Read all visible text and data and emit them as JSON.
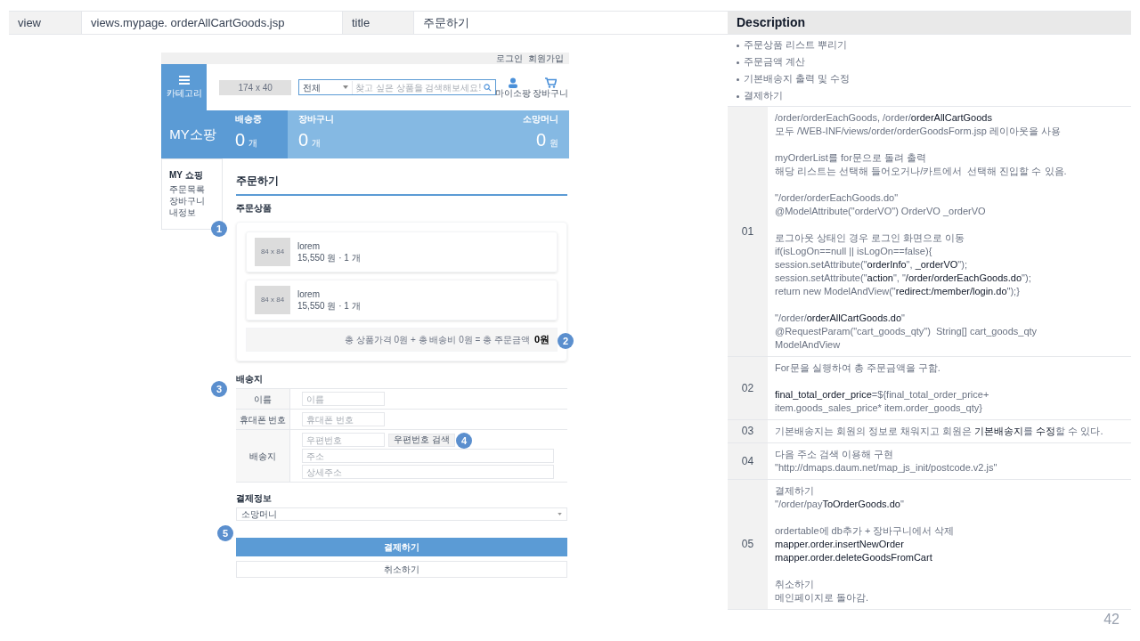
{
  "header": {
    "view_label": "view",
    "view_value": "views.mypage. orderAllCartGoods.jsp",
    "title_label": "title",
    "title_value": "주문하기",
    "description_label": "Description"
  },
  "mockup": {
    "top_links": [
      "로그인",
      "회원가입"
    ],
    "category_button": "카테고리",
    "logo_placeholder": "174 x 40",
    "search": {
      "category": "전체",
      "placeholder": "찾고 싶은 상품을 검색해보세요!"
    },
    "header_icons": [
      {
        "kind": "user",
        "label": "마이소팡"
      },
      {
        "kind": "cart",
        "label": "장바구니"
      }
    ],
    "banner": {
      "title": "MY소팡",
      "stats": [
        {
          "label": "배송중",
          "value": "0",
          "unit": "개"
        },
        {
          "label": "장바구니",
          "value": "0",
          "unit": "개"
        },
        {
          "label": "소망머니",
          "value": "0",
          "unit": "원"
        }
      ]
    },
    "sidebar": {
      "title": "MY 쇼핑",
      "items": [
        "주문목록",
        "장바구니",
        "내정보"
      ]
    },
    "page_title": "주문하기",
    "goods_section": "주문상품",
    "goods": [
      {
        "thumb": "84 x 84",
        "name": "lorem",
        "price": "15,550 원 · 1 개"
      },
      {
        "thumb": "84 x 84",
        "name": "lorem",
        "price": "15,550 원 · 1 개"
      }
    ],
    "summary": {
      "text": "총 상품가격 0원 + 총 배송비 0원 = 총 주문금액",
      "total": "0원"
    },
    "shipping_section": "배송지",
    "shipping_rows": [
      {
        "label": "이름",
        "fields": [
          {
            "placeholder": "이름"
          }
        ]
      },
      {
        "label": "휴대폰 번호",
        "fields": [
          {
            "placeholder": "휴대폰 번호"
          }
        ]
      },
      {
        "label": "배송지",
        "fields": [
          {
            "placeholder": "우편번호"
          },
          {
            "placeholder": "주소"
          },
          {
            "placeholder": "상세주소"
          }
        ],
        "search_button": "우편번호 검색"
      }
    ],
    "payment_section": "결제정보",
    "payment_select": "소망머니",
    "pay_button": "결제하기",
    "cancel_button": "취소하기",
    "markers": [
      "1",
      "2",
      "3",
      "4",
      "5"
    ]
  },
  "description": {
    "bullets": [
      "주문상품 리스트 뿌리기",
      "주문금액 계산",
      "기본배송지 출력 및 수정",
      "결제하기"
    ],
    "rows": [
      {
        "number": "01",
        "paragraphs": [
          [
            "/order/orderEachGoods, /order/**orderAllCartGoods**",
            "모두 /WEB-INF/views/order/orderGoodsForm.jsp 레이아웃을 사용"
          ],
          [
            "myOrderList를 for문으로 돌려 출력",
            "해당 리스트는 선택해 들어오거나/카트에서  선택해 진입할 수 있음."
          ],
          [
            "\"/order/orderEachGoods.do\"",
            "@ModelAttribute(\"orderVO\") OrderVO _orderVO"
          ],
          [
            "로그아웃 상태인 경우 로그인 화면으로 이동",
            "if(isLogOn==null || isLogOn==false){",
            "session.setAttribute(\"**orderInfo**\", **_orderVO**\");",
            "session.setAttribute(\"**action**\", \"**/order/orderEachGoods.do**\");",
            "return new ModelAndView(\"**redirect:/member/login.do**\");}"
          ],
          [
            "\"/order/**orderAllCartGoods.do**\"",
            "@RequestParam(\"cart_goods_qty\")  String[] cart_goods_qty",
            "ModelAndView"
          ]
        ]
      },
      {
        "number": "02",
        "paragraphs": [
          [
            "For문을 실행하여 총 주문금액을 구함."
          ],
          [
            "**final_total_order_price**=${final_total_order_price+",
            "item.goods_sales_price* item.order_goods_qty}"
          ]
        ]
      },
      {
        "number": "03",
        "paragraphs": [
          [
            "기본배송지는 회원의 정보로 채워지고 회원은 **기본배송지**를 **수정**할 수 있다."
          ]
        ]
      },
      {
        "number": "04",
        "paragraphs": [
          [
            "다음 주소 검색 이용해 구현",
            "\"http://dmaps.daum.net/map_js_init/postcode.v2.js\""
          ]
        ]
      },
      {
        "number": "05",
        "paragraphs": [
          [
            "결제하기",
            "\"/order/pay**ToOrderGoods.do**\""
          ],
          [
            "ordertable에 db추가 + 장바구니에서 삭제",
            "**mapper.order.insertNewOrder**",
            "**mapper.order.deleteGoodsFromCart**"
          ],
          [
            "취소하기",
            "메인페이지로 돌아감."
          ]
        ]
      }
    ]
  },
  "page_number": "42"
}
